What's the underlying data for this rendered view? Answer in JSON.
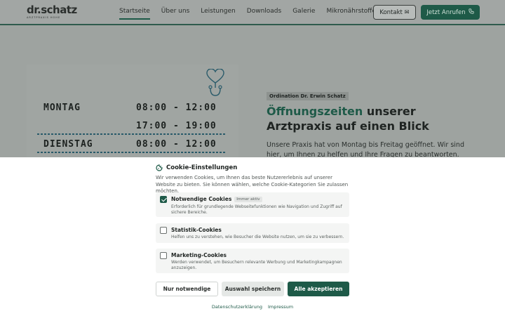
{
  "header": {
    "logo": "dr.schatz",
    "logo_sub": "ARZTPRAXIS HOHE",
    "nav": [
      {
        "label": "Startseite",
        "active": true
      },
      {
        "label": "Über uns"
      },
      {
        "label": "Leistungen"
      },
      {
        "label": "Downloads"
      },
      {
        "label": "Galerie"
      },
      {
        "label": "Mikronährstoffe",
        "dropdown": true
      }
    ],
    "kontakt_label": "Kontakt ✉",
    "call_label": "Jetzt Anrufen",
    "call_icon": "phone-icon"
  },
  "schedule": {
    "rows": [
      {
        "day": "MONTAG",
        "time": "08:00 - 12:00"
      },
      {
        "day": "",
        "time": "17:00 - 19:00"
      },
      {
        "day": "DIENSTAG",
        "time": "08:00 - 12:00"
      }
    ],
    "icon": "heart-stethoscope-icon"
  },
  "hero": {
    "badge": "Ordination Dr. Erwin Schatz",
    "headline_accent": "Öffnungszeiten",
    "headline_rest1": " unserer",
    "headline_line2": "Arztpraxis auf einen Blick",
    "intro": "Unsere Praxis hat von Montag bis Freitag geöffnet. Wir sind hier, um Ihnen zu helfen und Ihre Fragen zu beantworten."
  },
  "cookie": {
    "title": "Cookie-Einstellungen",
    "description": "Wir verwenden Cookies, um Ihnen das beste Nutzererlebnis auf unserer Website zu bieten. Sie können wählen, welche Cookie-Kategorien Sie zulassen möchten.",
    "options": [
      {
        "name": "Notwendige Cookies",
        "tag": "Immer aktiv",
        "checked": true,
        "desc": "Erforderlich für grundlegende Webseitefunktionen wie Navigation und Zugriff auf sichere Bereiche."
      },
      {
        "name": "Statistik-Cookies",
        "checked": false,
        "desc": "Helfen uns zu verstehen, wie Besucher die Website nutzen, um sie zu verbessern."
      },
      {
        "name": "Marketing-Cookies",
        "checked": false,
        "desc": "Werden verwendet, um Besuchern relevante Werbung und Marketingkampagnen anzuzeigen."
      }
    ],
    "buttons": {
      "reject": "Nur notwendige",
      "save": "Auswahl speichern",
      "accept": "Alle akzeptieren"
    },
    "links": {
      "privacy": "Datenschutzerklärung",
      "imprint": "Impressum"
    }
  },
  "colors": {
    "brand_green": "#1e5a48",
    "overlay_gray": "#9ea3a0"
  }
}
